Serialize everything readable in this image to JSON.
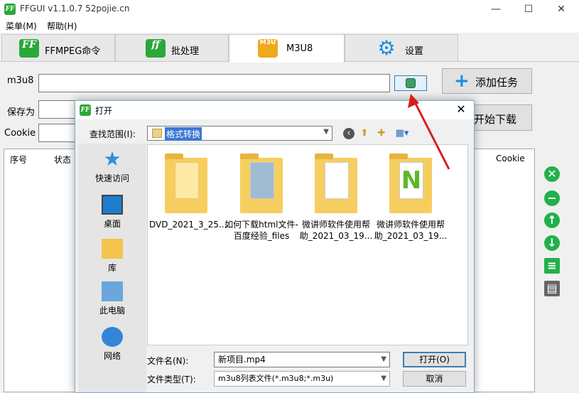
{
  "window": {
    "title": "FFGUI v1.1.0.7    52pojie.cn",
    "icon_text": "FF"
  },
  "menu": [
    "菜单(M)",
    "帮助(H)"
  ],
  "tabs": [
    {
      "label": "FFMPEG命令",
      "icon": "FF"
    },
    {
      "label": "批处理",
      "icon": "ff"
    },
    {
      "label": "M3U8",
      "icon": "M3U"
    },
    {
      "label": "设置",
      "icon": "gear-icon"
    }
  ],
  "form": {
    "m3u8_label": "m3u8",
    "save_as_label": "保存为",
    "cookie_label": "Cookie",
    "add_task_label": "添加任务",
    "start_download_label": "开始下载"
  },
  "table": {
    "columns": [
      "序号",
      "状态",
      "Cookie"
    ]
  },
  "dialog": {
    "title": "打开",
    "look_in_label": "查找范围(I):",
    "look_in_value": "格式转换",
    "places": [
      "快速访问",
      "桌面",
      "库",
      "此电脑",
      "网络"
    ],
    "files": [
      {
        "name": "DVD_2021_3_25..."
      },
      {
        "name": "如何下载html文件-百度经验_files"
      },
      {
        "name": "微讲师软件使用帮助_2021_03_19..."
      },
      {
        "name": "微讲师软件使用帮助_2021_03_19..."
      }
    ],
    "filename_label": "文件名(N):",
    "filename_value": "新项目.mp4",
    "filetype_label": "文件类型(T):",
    "filetype_value": "m3u8列表文件(*.m3u8;*.m3u)",
    "open_label": "打开(O)",
    "cancel_label": "取消"
  },
  "colors": {
    "accent_blue": "#1c8ce0",
    "ff_green": "#2aa83a",
    "arrow_red": "#d81e1e"
  }
}
